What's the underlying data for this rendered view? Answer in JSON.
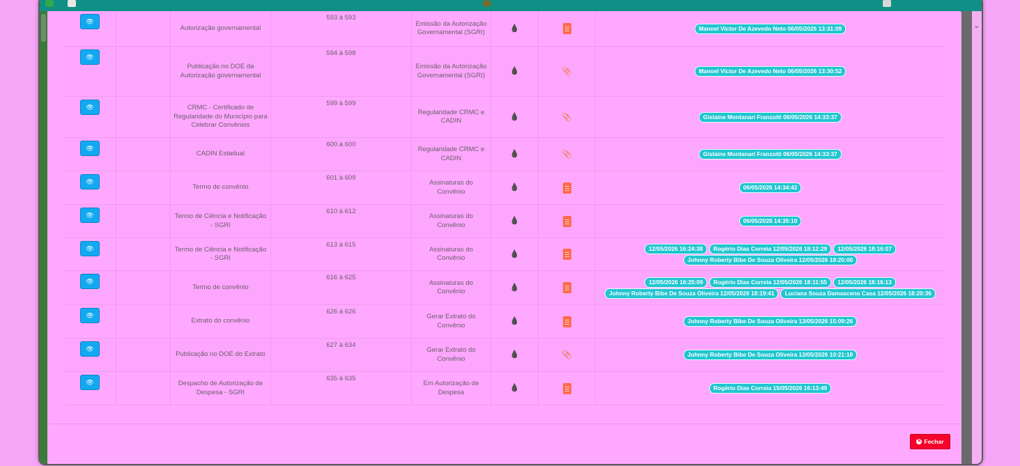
{
  "rows": [
    {
      "document": "Autorização governamental",
      "pages": "593 à 593",
      "stage": "Emissão da Autorização Governamental (SGRI)",
      "file_icon": "pdf-icon",
      "signatures": [
        [
          "Manoel Victor De Azevedo Neto 06/05/2026 13:31:09"
        ]
      ]
    },
    {
      "document": "Publicação no DOE da Autorização governamental",
      "pages": "594 à 598",
      "stage": "Emissão da Autorização Governamental (SGRI)",
      "file_icon": "paperclip-icon",
      "signatures": [
        [
          "Manoel Victor De Azevedo Neto 06/05/2026 13:30:52"
        ]
      ]
    },
    {
      "document": "CRMC - Certificado de Regularidade do Município para Celebrar Convênios",
      "pages": "599 à 599",
      "stage": "Regularidade CRMC e CADIN",
      "file_icon": "paperclip-icon",
      "signatures": [
        [
          "Gislaine Montanari Franzotti 06/05/2026 14:33:37"
        ]
      ]
    },
    {
      "document": "CADIN Estadual",
      "pages": "600 à 600",
      "stage": "Regularidade CRMC e CADIN",
      "file_icon": "paperclip-icon",
      "signatures": [
        [
          "Gislaine Montanari Franzotti 06/05/2026 14:33:37"
        ]
      ]
    },
    {
      "document": "Termo de convênio",
      "pages": "601 à 609",
      "stage": "Assinaturas do Convênio",
      "file_icon": "pdf-icon",
      "signatures": [
        [
          "06/05/2026 14:34:42"
        ]
      ]
    },
    {
      "document": "Termo de Ciência e Notificação - SGRI",
      "pages": "610 à 612",
      "stage": "Assinaturas do Convênio",
      "file_icon": "pdf-icon",
      "signatures": [
        [
          "06/05/2026 14:35:10"
        ]
      ]
    },
    {
      "document": "Termo de Ciência e Notificação - SGRI",
      "pages": "613 à 615",
      "stage": "Assinaturas do Convênio",
      "file_icon": "pdf-icon",
      "signatures": [
        [
          "12/05/2026 16:24:38",
          "Rogério Dias Correia 12/05/2026 18:12:29",
          "12/05/2026 18:16:07"
        ],
        [
          "Johnny Roberty Bibe De Souza Oliveira 12/05/2026 18:20:00"
        ]
      ]
    },
    {
      "document": "Termo de convênio",
      "pages": "616 à 625",
      "stage": "Assinaturas do Convênio",
      "file_icon": "pdf-icon",
      "signatures": [
        [
          "12/05/2026 16:25:09",
          "Rogério Dias Correia 12/05/2026 18:11:55",
          "12/05/2026 18:16:13"
        ],
        [
          "Johnny Roberty Bibe De Souza Oliveira 12/05/2026 18:19:41",
          "Luciana Souza Damasceno Casa 12/05/2026 18:20:36"
        ]
      ]
    },
    {
      "document": "Extrato do convênio",
      "pages": "626 à 626",
      "stage": "Gerar Extrato do Convênio",
      "file_icon": "pdf-icon",
      "signatures": [
        [
          "Johnny Roberty Bibe De Souza Oliveira 13/05/2026 15:09:26"
        ]
      ]
    },
    {
      "document": "Publicação no DOE do Extrato",
      "pages": "627 à 634",
      "stage": "Gerar Extrato do Convênio",
      "file_icon": "paperclip-icon",
      "signatures": [
        [
          "Johnny Roberty Bibe De Souza Oliveira 13/05/2026 10:21:18"
        ]
      ]
    },
    {
      "document": "Despacho de Autorização de Despesa - SGRI",
      "pages": "635 à 635",
      "stage": "Em Autorização de Despesa",
      "file_icon": "pdf-icon",
      "signatures": [
        [
          "Rogério Dias Correia 15/05/2026 16:13:49"
        ]
      ]
    }
  ],
  "footer": {
    "close_label": "Fechar"
  },
  "colors": {
    "view_button": "#13a9f2",
    "signature_tag": "#20c5d0",
    "close_button": "#f5032b",
    "background": "#ffa8ff"
  }
}
